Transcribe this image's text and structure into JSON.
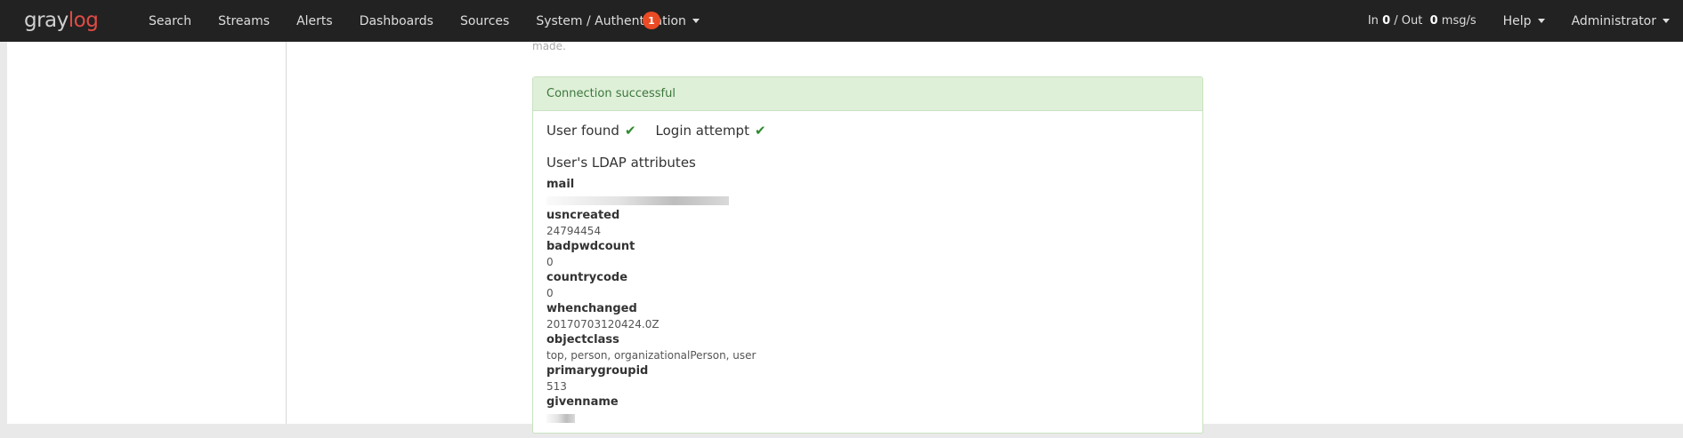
{
  "navbar": {
    "brand_main": "gray",
    "brand_accent": "log",
    "links": [
      "Search",
      "Streams",
      "Alerts",
      "Dashboards",
      "Sources"
    ],
    "system_menu": "System / Authentication",
    "notification_count": "1",
    "throughput": {
      "in_label": "In ",
      "in_value": "0",
      "sep": " / Out ",
      "out_value": "0",
      "unit": " msg/s"
    },
    "help_menu": "Help",
    "user_menu": "Administrator"
  },
  "page": {
    "faded_text": "made."
  },
  "connection_panel": {
    "heading": "Connection successful",
    "user_found": "User found",
    "login_attempt": "Login attempt",
    "check_glyph": "✔",
    "attributes_title": "User's LDAP attributes",
    "attributes": [
      {
        "name": "mail",
        "value": "",
        "redacted": true
      },
      {
        "name": "usncreated",
        "value": "24794454"
      },
      {
        "name": "badpwdcount",
        "value": "0"
      },
      {
        "name": "countrycode",
        "value": "0"
      },
      {
        "name": "whenchanged",
        "value": "20170703120424.0Z"
      },
      {
        "name": "objectclass",
        "value": "top, person, organizationalPerson, user"
      },
      {
        "name": "primarygroupid",
        "value": "513"
      },
      {
        "name": "givenname",
        "value": "",
        "redacted": true
      }
    ]
  }
}
